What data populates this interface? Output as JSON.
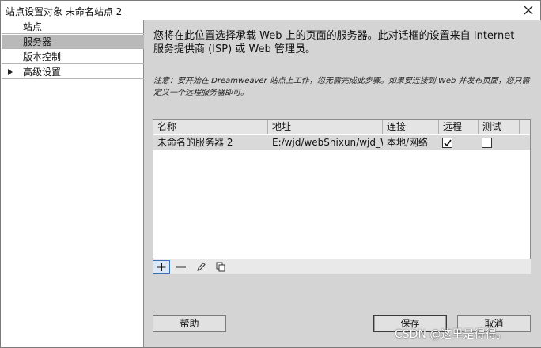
{
  "window": {
    "title": "站点设置对象 未命名站点 2"
  },
  "sidebar": {
    "items": [
      {
        "label": "站点"
      },
      {
        "label": "服务器",
        "active": true
      },
      {
        "label": "版本控制"
      },
      {
        "label": "高级设置",
        "expandable": true
      }
    ]
  },
  "main": {
    "intro": "您将在此位置选择承载 Web 上的页面的服务器。此对话框的设置来自 Internet 服务提供商 (ISP) 或 Web 管理员。",
    "note": "注意：要开始在 Dreamweaver 站点上工作，您无需完成此步骤。如果要连接到 Web 并发布页面，您只需定义一个远程服务器即可。"
  },
  "server_table": {
    "columns": [
      "名称",
      "地址",
      "连接",
      "远程",
      "测试"
    ],
    "rows": [
      {
        "name": "未命名的服务器 2",
        "address": "E:/wjd/webShixun/wjd_W...",
        "connection": "本地/网络",
        "remote": true,
        "test": false
      }
    ]
  },
  "toolbar": {
    "icons": [
      "plus-icon",
      "minus-icon",
      "pencil-icon",
      "duplicate-icon"
    ]
  },
  "buttons": {
    "help": "帮助",
    "save": "保存",
    "cancel": "取消"
  },
  "watermark": "CSDN @这里是得得。"
}
